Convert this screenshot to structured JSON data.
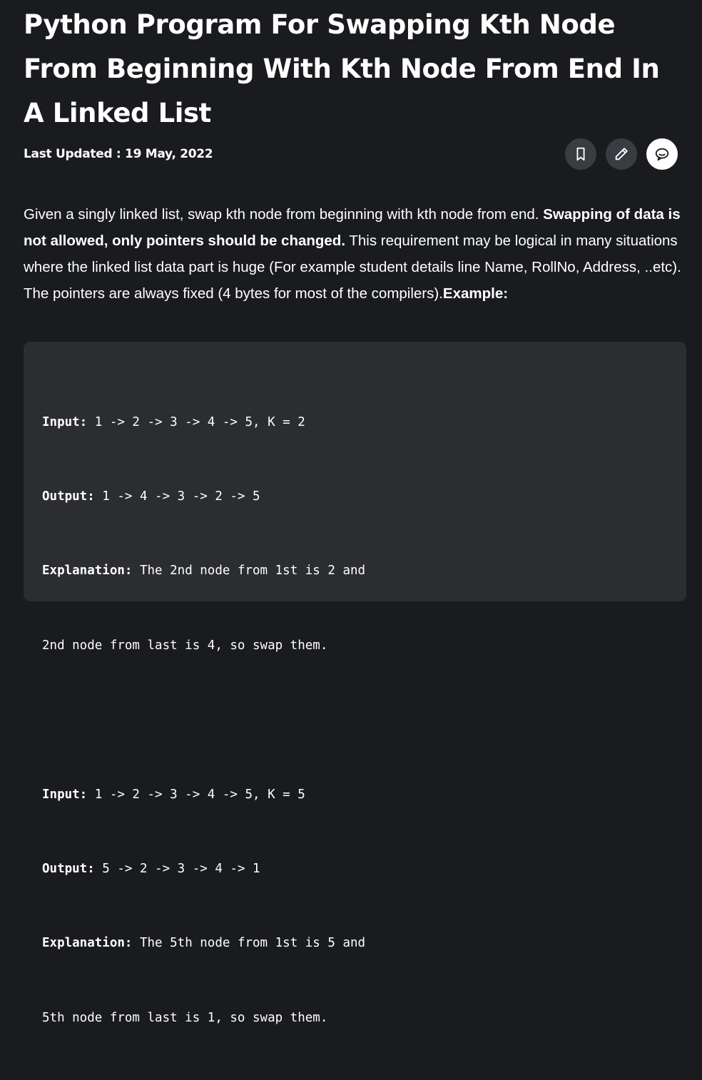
{
  "article": {
    "title": "Python Program For Swapping Kth Node From Beginning With Kth Node From End In A Linked List",
    "last_updated": "Last Updated : 19 May, 2022",
    "actions": [
      {
        "icon": "bookmark-icon"
      },
      {
        "icon": "pencil-icon"
      },
      {
        "icon": "comment-icon"
      }
    ],
    "intro": {
      "part1": "Given a singly linked list, swap kth node from beginning with kth node from end. ",
      "bold1": "Swapping of data is not allowed, only pointers should be changed.",
      "part2": " This requirement may be logical in many situations where the linked list data part is huge (For example student details line Name, RollNo, Address, ..etc). The pointers are always fixed (4 bytes for most of the compilers).",
      "bold2": "Example:"
    },
    "example": {
      "lines": [
        {
          "label": "Input:",
          "text": " 1 -> 2 -> 3 -> 4 -> 5, K = 2"
        },
        {
          "label": "Output:",
          "text": " 1 -> 4 -> 3 -> 2 -> 5"
        },
        {
          "label": "Explanation:",
          "text": " The 2nd node from 1st is 2 and"
        },
        {
          "label": "",
          "text": "2nd node from last is 4, so swap them."
        },
        {
          "label": "",
          "text": ""
        },
        {
          "label": "Input:",
          "text": " 1 -> 2 -> 3 -> 4 -> 5, K = 5"
        },
        {
          "label": "Output:",
          "text": " 5 -> 2 -> 3 -> 4 -> 1"
        },
        {
          "label": "Explanation:",
          "text": " The 5th node from 1st is 5 and"
        },
        {
          "label": "",
          "text": "5th node from last is 1, so swap them."
        }
      ]
    }
  },
  "colors": {
    "background": "#1a1b1e",
    "code_background": "#2c2d30",
    "icon_button": "#3a3c41",
    "text": "#ffffff"
  }
}
